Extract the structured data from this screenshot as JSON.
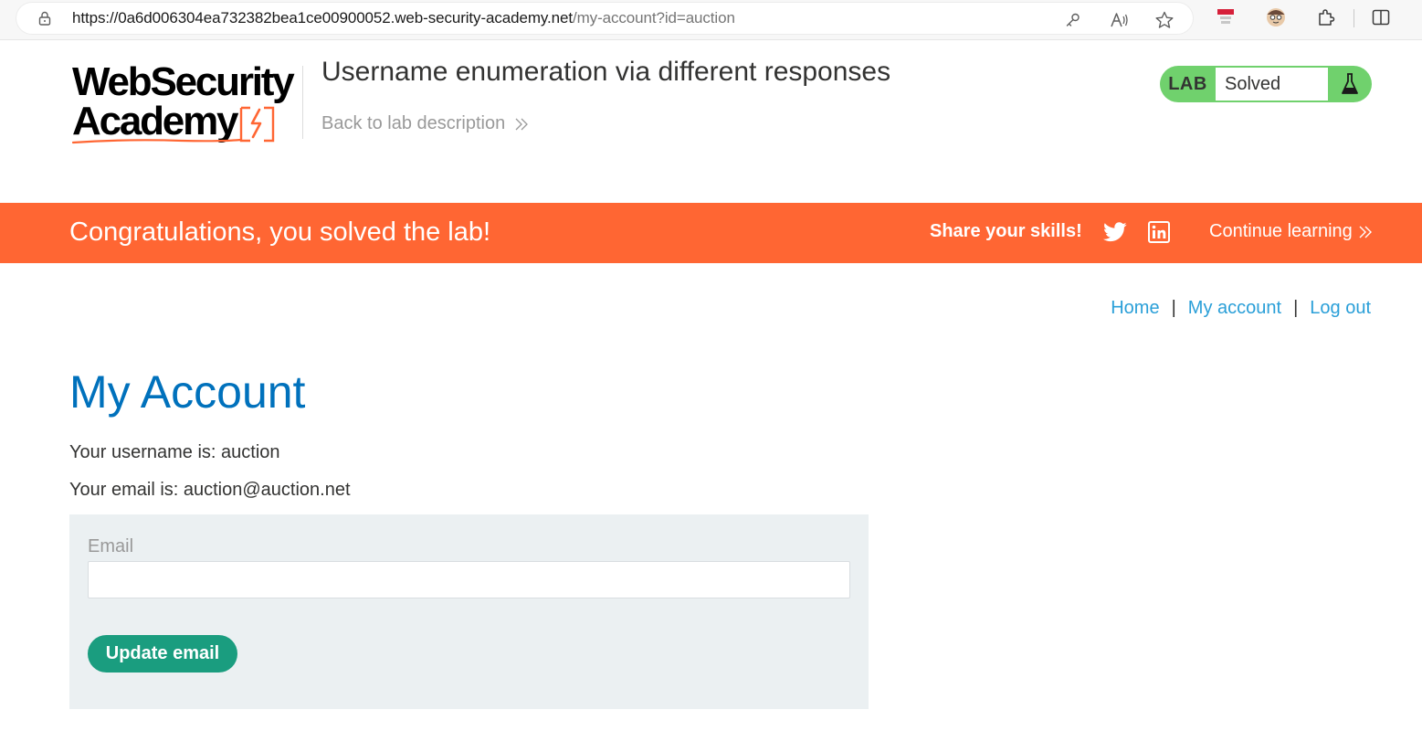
{
  "browser": {
    "url_host": "https://0a6d006304ea732382bea1ce00900052.web-security-academy.net",
    "url_path": "/my-account?id=auction",
    "icons": [
      "lock-icon",
      "key-icon",
      "read-aloud-icon",
      "favorite-star-icon",
      "extension-badge-icon",
      "profile-avatar-icon",
      "extensions-puzzle-icon",
      "split-screen-icon"
    ]
  },
  "header": {
    "logo_line1": "WebSecurity",
    "logo_line2": "Academy",
    "lab_title": "Username enumeration via different responses",
    "back_link": "Back to lab description",
    "lab_badge": "LAB",
    "lab_status": "Solved"
  },
  "banner": {
    "title": "Congratulations, you solved the lab!",
    "share": "Share your skills!",
    "continue": "Continue learning"
  },
  "nav": {
    "home": "Home",
    "separator": "|",
    "my_account": "My account",
    "log_out": "Log out"
  },
  "main": {
    "title": "My Account",
    "username_line": "Your username is: auction",
    "email_line": "Your email is: auction@auction.net",
    "form": {
      "email_label": "Email",
      "email_value": "",
      "submit_label": "Update email"
    }
  },
  "colors": {
    "brand_orange": "#ff6633",
    "lab_solved_green": "#70d16d",
    "link_blue": "#2a9fd8",
    "title_blue": "#0071bc",
    "button_green": "#1a9d7f",
    "panel_gray": "#ebf0f2"
  }
}
